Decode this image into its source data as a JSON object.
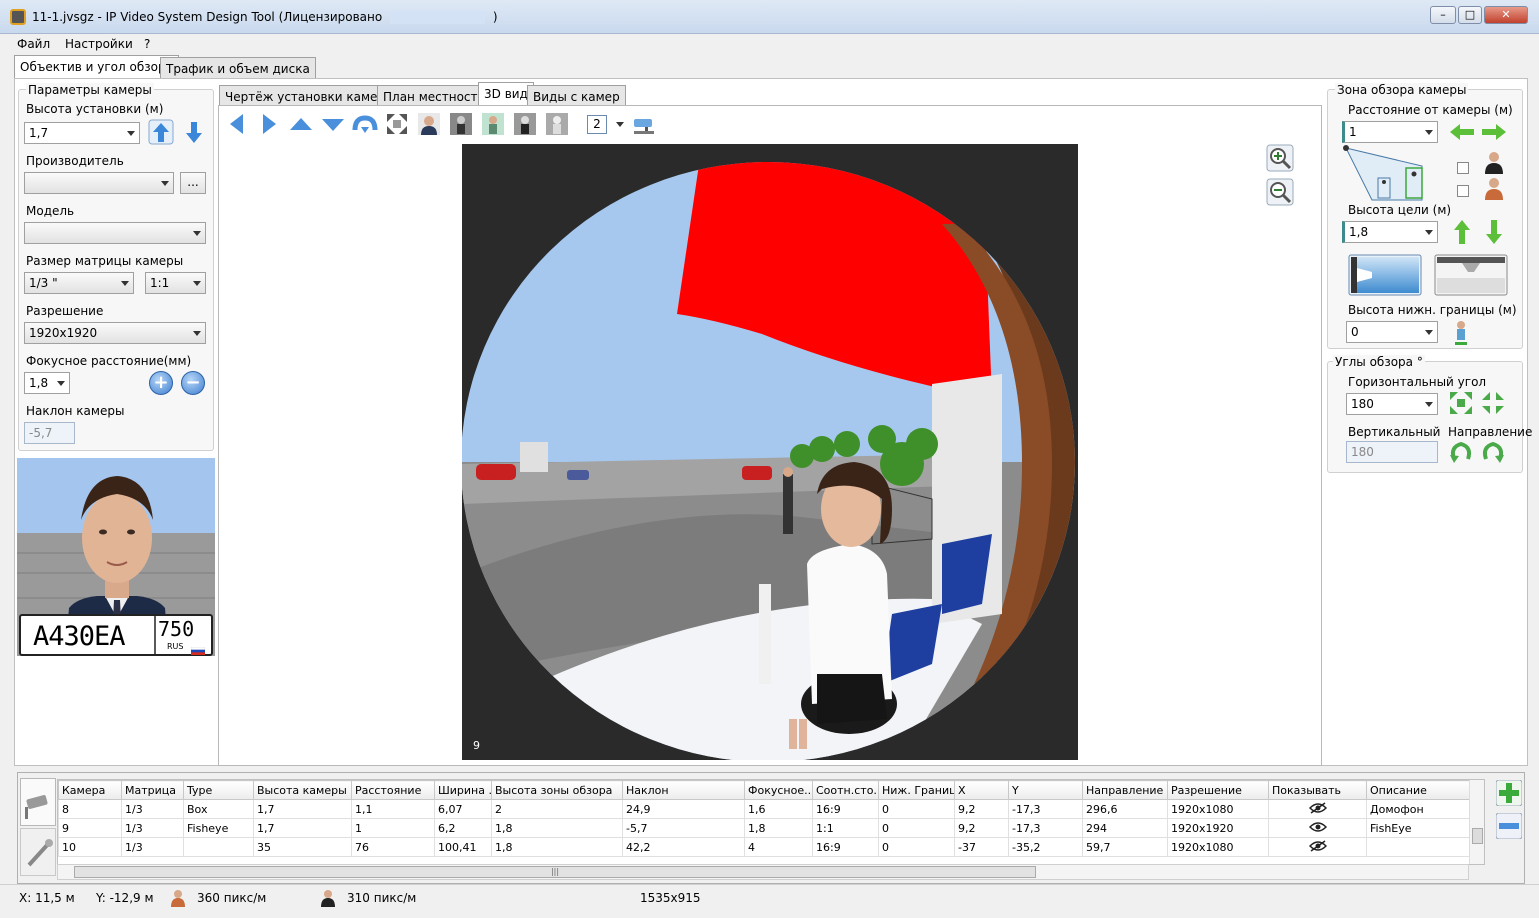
{
  "window": {
    "title": "11-1.jvsgz - IP Video System Design Tool (Лицензировано",
    "title_suffix": ")",
    "minimize": "–",
    "maximize": "□",
    "close": "✕"
  },
  "menu": [
    "Файл",
    "Настройки",
    "?"
  ],
  "main_tabs": [
    "Объектив и угол обзора",
    "Трафик и объем диска"
  ],
  "view_tabs": [
    "Чертёж установки камеры",
    "План местности",
    "3D вид",
    "Виды с камер"
  ],
  "camera_params": {
    "group_title": "Параметры камеры",
    "height_label": "Высота установки (м)",
    "height_value": "1,7",
    "manufacturer_label": "Производитель",
    "manufacturer_value": "",
    "manufacturer_browse": "...",
    "model_label": "Модель",
    "model_value": "",
    "sensor_label": "Размер матрицы камеры",
    "sensor_value": "1/3 \"",
    "aspect_value": "1:1",
    "resolution_label": "Разрешение",
    "resolution_value": "1920x1920",
    "focal_label": "Фокусное расстояние(мм)",
    "focal_value": "1,8",
    "tilt_label": "Наклон камеры",
    "tilt_value": "-5,7"
  },
  "preview": {
    "plate_text": "А430ЕА",
    "plate_region": "750",
    "plate_country": "RUS"
  },
  "toolbar": {
    "count_value": "2"
  },
  "view3d": {
    "corner_label": "9"
  },
  "zone": {
    "group_title": "Зона обзора камеры",
    "distance_label": "Расстояние от камеры (м)",
    "distance_value": "1",
    "target_height_label": "Высота цели (м)",
    "target_height_value": "1,8",
    "lower_bound_label": "Высота нижн. границы (м)",
    "lower_bound_value": "0"
  },
  "angles": {
    "group_title": "Углы обзора °",
    "horizontal_label": "Горизонтальный угол",
    "horizontal_value": "180",
    "vertical_label": "Вертикальный",
    "vertical_value": "180",
    "direction_label": "Направление"
  },
  "table": {
    "columns": [
      "Камера",
      "Матрица",
      "Type",
      "Высота камеры",
      "Расстояние",
      "Ширина ...",
      "Высота зоны обзора",
      "Наклон",
      "Фокусное...",
      "Соотн.сто...",
      "Ниж. Граница",
      "X",
      "Y",
      "Направление",
      "Разрешение",
      "Показывать",
      "Описание"
    ],
    "rows": [
      [
        "8",
        "1/3",
        "Box",
        "1,7",
        "1,1",
        "6,07",
        "2",
        "24,9",
        "1,6",
        "16:9",
        "0",
        "9,2",
        "-17,3",
        "296,6",
        "1920x1080",
        "hidden",
        "Домофон"
      ],
      [
        "9",
        "1/3",
        "Fisheye",
        "1,7",
        "1",
        "6,2",
        "1,8",
        "-5,7",
        "1,8",
        "1:1",
        "0",
        "9,2",
        "-17,3",
        "294",
        "1920x1920",
        "visible",
        "FishEye"
      ],
      [
        "10",
        "1/3",
        "",
        "35",
        "76",
        "100,41",
        "1,8",
        "42,2",
        "4",
        "16:9",
        "0",
        "-37",
        "-35,2",
        "59,7",
        "1920x1080",
        "hidden",
        ""
      ]
    ],
    "hscroll_grip": "|||"
  },
  "status": {
    "x": "X: 11,5 м",
    "y": "Y: -12,9 м",
    "ppm1": "360 пикс/м",
    "ppm2": "310 пикс/м",
    "size": "1535x915"
  }
}
